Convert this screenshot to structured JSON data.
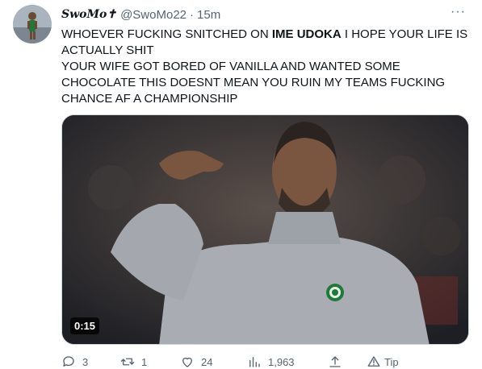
{
  "tweet": {
    "display_name": "SwoMo✝",
    "handle": "@SwoMo22",
    "separator": "·",
    "time": "15m",
    "more_label": "···",
    "text_before": "WHOEVER FUCKING SNITCHED ON ",
    "text_bold": "IME UDOKA",
    "text_after": " I HOPE YOUR LIFE IS ACTUALLY SHIT",
    "text_line2": "YOUR WIFE GOT BORED OF VANILLA AND WANTED SOME CHOCOLATE THIS DOESNT MEAN YOU RUIN MY TEAMS FUCKING CHANCE AF A CHAMPIONSHIP"
  },
  "media": {
    "duration": "0:15"
  },
  "actions": {
    "replies": "3",
    "retweets": "1",
    "likes": "24",
    "views": "1,963",
    "tip_label": "Tip"
  },
  "colors": {
    "text": "#0f1419",
    "secondary": "#536471",
    "border": "#cfd9de"
  }
}
